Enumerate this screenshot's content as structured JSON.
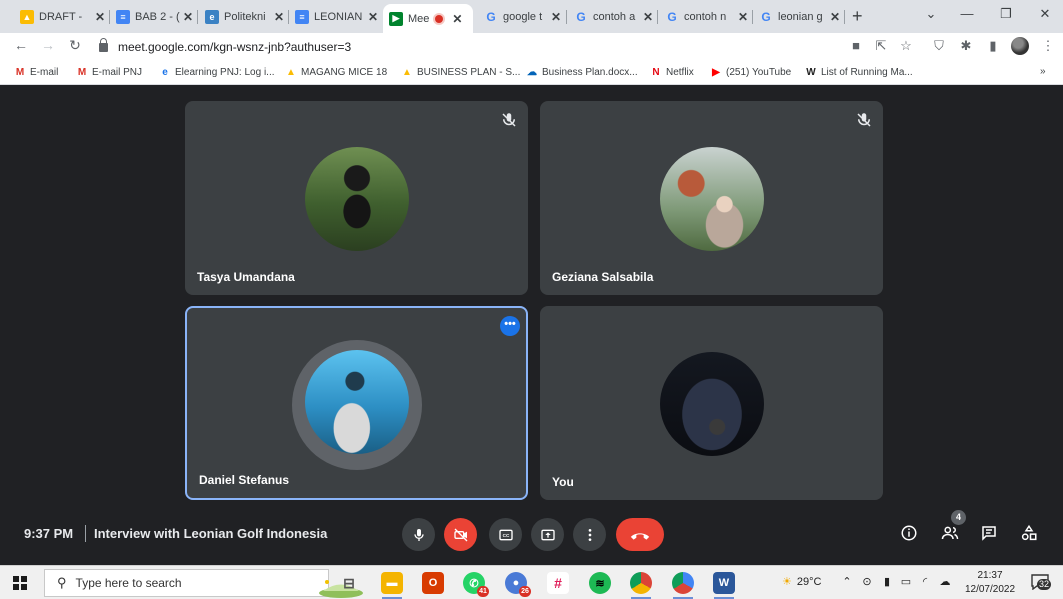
{
  "browser": {
    "tabs": [
      {
        "label": "DRAFT - ",
        "favicon": "google-drive-icon",
        "color": "#1a73e8"
      },
      {
        "label": "BAB 2 - (",
        "favicon": "google-docs-icon",
        "color": "#4285f4"
      },
      {
        "label": "Politekni",
        "favicon": "elearning-icon",
        "color": "#3b82c4"
      },
      {
        "label": "LEONIAN",
        "favicon": "google-docs-icon",
        "color": "#4285f4"
      },
      {
        "label": "Mee",
        "favicon": "google-meet-icon",
        "color": "#00832d",
        "active": true
      },
      {
        "label": "google t",
        "favicon": "google-icon",
        "color": "#4285f4"
      },
      {
        "label": "contoh a",
        "favicon": "google-icon",
        "color": "#4285f4"
      },
      {
        "label": "contoh n",
        "favicon": "google-icon",
        "color": "#4285f4"
      },
      {
        "label": "leonian g",
        "favicon": "google-icon",
        "color": "#4285f4"
      }
    ],
    "new_tab": "+",
    "url": "meet.google.com/kgn-wsnz-jnb?authuser=3"
  },
  "bookmarks": [
    {
      "label": "E-mail",
      "icon": "gmail-icon",
      "color": "#d93025"
    },
    {
      "label": "E-mail PNJ",
      "icon": "gmail-icon",
      "color": "#d93025"
    },
    {
      "label": "Elearning PNJ: Log i...",
      "icon": "elearning-icon",
      "color": "#1a73e8"
    },
    {
      "label": "MAGANG MICE 18",
      "icon": "google-drive-icon",
      "color": "#fbbc04"
    },
    {
      "label": "BUSINESS PLAN - S...",
      "icon": "google-drive-icon",
      "color": "#fbbc04"
    },
    {
      "label": "Business Plan.docx...",
      "icon": "onedrive-icon",
      "color": "#0364b8"
    },
    {
      "label": "Netflix",
      "icon": "netflix-icon",
      "color": "#e50914"
    },
    {
      "label": "(251) YouTube",
      "icon": "youtube-icon",
      "color": "#ff0000"
    },
    {
      "label": "List of Running Ma...",
      "icon": "wikipedia-icon",
      "color": "#222222"
    }
  ],
  "bookmarks_overflow": "»",
  "participants": [
    {
      "name": "Tasya Umandana",
      "muted": true,
      "avatar_colors": [
        "#5a7a3a",
        "#2e4a22"
      ]
    },
    {
      "name": "Geziana Salsabila",
      "muted": true,
      "avatar_colors": [
        "#9aa7a0",
        "#5a7352"
      ]
    },
    {
      "name": "Daniel Stefanus",
      "muted": false,
      "active": true,
      "avatar_colors": [
        "#3fa4d8",
        "#1e6a9a"
      ]
    },
    {
      "name": "You",
      "muted": false,
      "avatar_colors": [
        "#1d2230",
        "#0a0c12"
      ]
    }
  ],
  "meeting": {
    "time": "9:37 PM",
    "title": "Interview with Leonian Golf Indonesia",
    "people_count": "4",
    "accent": "#8ab4f8",
    "danger": "#ea4335"
  },
  "taskbar": {
    "search_placeholder": "Type here to search",
    "apps": [
      {
        "icon": "task-view-icon",
        "color": "#555555"
      },
      {
        "icon": "file-explorer-icon",
        "color": "#f4b400"
      },
      {
        "icon": "office-icon",
        "color": "#d83b01"
      },
      {
        "icon": "whatsapp-icon",
        "color": "#25d366",
        "badge": "41"
      },
      {
        "icon": "chrome-profile-icon",
        "color": "#4a7ad6",
        "badge": "26"
      },
      {
        "icon": "slack-icon",
        "color": "#ffffff"
      },
      {
        "icon": "spotify-icon",
        "color": "#1db954"
      },
      {
        "icon": "chrome-icon",
        "color": "#db4437"
      },
      {
        "icon": "chrome-icon-2",
        "color": "#4285f4"
      },
      {
        "icon": "word-icon",
        "color": "#2b579a"
      }
    ],
    "weather": "29°C",
    "time": "21:37",
    "date": "12/07/2022",
    "notifications": "32"
  }
}
